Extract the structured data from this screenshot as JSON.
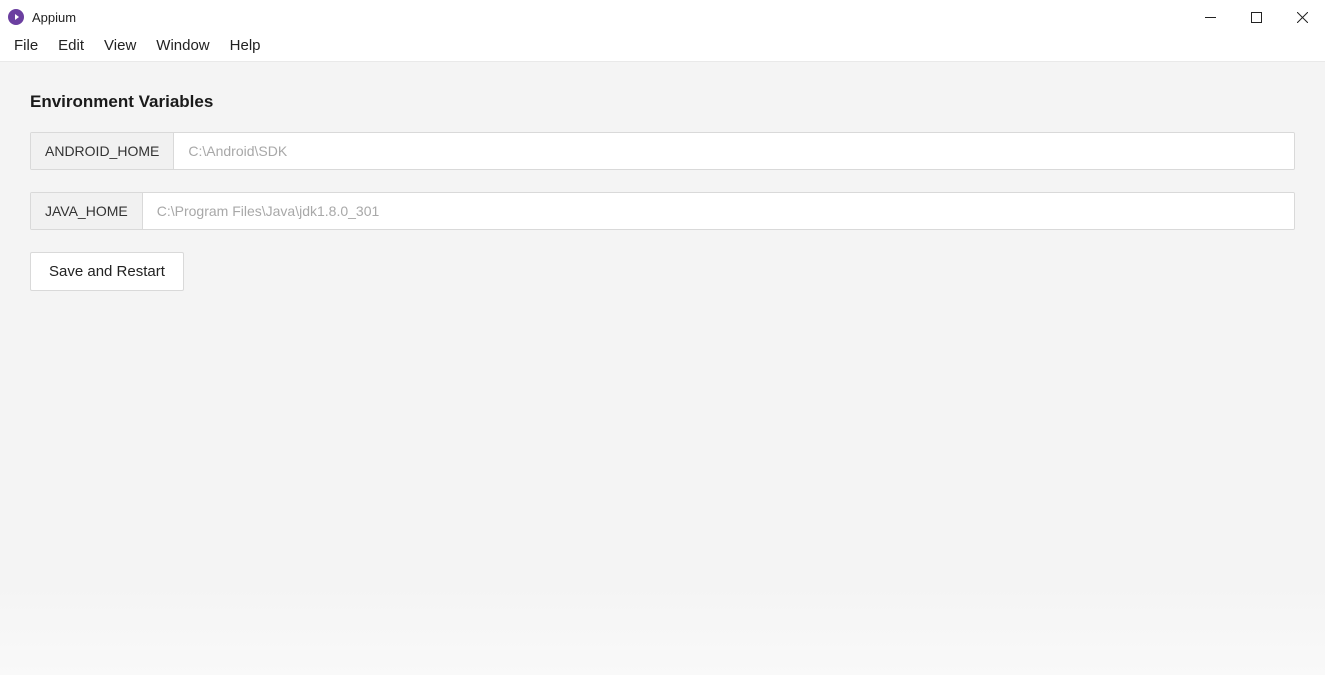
{
  "window": {
    "title": "Appium"
  },
  "menu": {
    "items": [
      "File",
      "Edit",
      "View",
      "Window",
      "Help"
    ]
  },
  "main": {
    "heading": "Environment Variables",
    "vars": [
      {
        "name": "ANDROID_HOME",
        "placeholder": "C:\\Android\\SDK",
        "value": ""
      },
      {
        "name": "JAVA_HOME",
        "placeholder": "C:\\Program Files\\Java\\jdk1.8.0_301",
        "value": ""
      }
    ],
    "save_label": "Save and Restart"
  }
}
